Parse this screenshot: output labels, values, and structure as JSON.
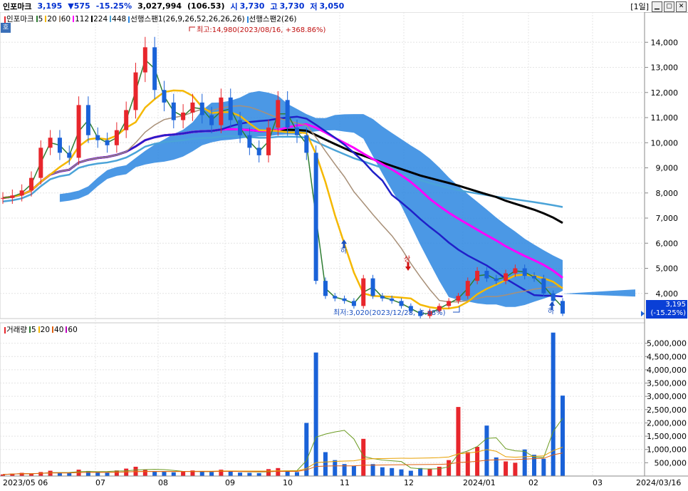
{
  "header": {
    "name": "인포마크",
    "price": "3,195",
    "change": "▼575",
    "change_pct": "-15.25%",
    "volume": "3,027,994",
    "vol_ratio": "(106.53)",
    "open_label": "시",
    "open": "3,730",
    "high_label": "고",
    "high": "3,730",
    "low_label": "저",
    "low": "3,050",
    "period": "[1일]"
  },
  "price_legend": {
    "name": "인포마크",
    "ma": [
      "5",
      "20",
      "60",
      "112",
      "224",
      "448"
    ],
    "span1": "선행스팬1(26,9,26,52,26,26,26)",
    "span2": "선행스팬2(26)",
    "ho_button": "호"
  },
  "volume_legend": {
    "name": "거래량",
    "ma": [
      "5",
      "20",
      "40",
      "60"
    ]
  },
  "annotations": {
    "high": "최고:14,980(2023/08/16, +368.86%)",
    "low": "최저:3,020(2023/12/28, -5.48%)",
    "ha1": "하",
    "sang": "상",
    "ha2": "하"
  },
  "price_box": {
    "price": "3,195",
    "pct": "(-15.25%)"
  },
  "colors": {
    "up": "#e8262c",
    "down": "#1a62d8",
    "ma5": "#2e7d32",
    "ma20": "#f5b800",
    "ma60": "#a89078",
    "ma112": "#ff00ff",
    "ma224": "#000000",
    "ma448": "#4aa3d8",
    "cloud": "#2b86e0",
    "ma_blue": "#2020c8"
  },
  "chart_data": [
    {
      "type": "candlestick",
      "title": "인포마크",
      "y_ticks": [
        4000,
        5000,
        6000,
        7000,
        8000,
        9000,
        10000,
        11000,
        12000,
        13000,
        14000
      ],
      "y_tick_labels": [
        "4,000",
        "5,000",
        "6,000",
        "7,000",
        "8,000",
        "9,000",
        "10,000",
        "11,000",
        "12,000",
        "13,000",
        "14,000"
      ],
      "ylim": [
        3000,
        15200
      ],
      "x_labels": [
        "2023/05 06",
        "07",
        "08",
        "09",
        "10",
        "11",
        "12",
        "2024/01",
        "02",
        "03",
        "2024/03/16"
      ],
      "closes": [
        7800,
        7900,
        8100,
        8600,
        9800,
        10200,
        9600,
        9400,
        11500,
        10300,
        10100,
        9900,
        10500,
        11300,
        12800,
        13800,
        12100,
        11600,
        10900,
        11200,
        11600,
        11100,
        10700,
        11800,
        10900,
        10300,
        9800,
        9500,
        10600,
        11700,
        10600,
        10300,
        9600,
        4500,
        3900,
        3800,
        3700,
        3500,
        4600,
        3900,
        3800,
        3700,
        3500,
        3300,
        3100,
        3300,
        3500,
        3700,
        3900,
        4500,
        4900,
        4600,
        4500,
        4800,
        5000,
        4700,
        4600,
        4000,
        3700,
        3195
      ],
      "last": 3195,
      "high": 14980,
      "low": 3020
    },
    {
      "type": "bar",
      "title": "거래량",
      "y_ticks": [
        500000,
        1000000,
        1500000,
        2000000,
        2500000,
        3000000,
        3500000,
        4000000,
        4500000,
        5000000
      ],
      "y_tick_labels": [
        "500,000",
        "1,000,000",
        "1,500,000",
        "2,000,000",
        "2,500,000",
        "3,000,000",
        "3,500,000",
        "4,000,000",
        "4,500,000",
        "5,000,000"
      ],
      "ylim": [
        0,
        5500000
      ],
      "values": [
        60000,
        90000,
        120000,
        80000,
        150000,
        200000,
        110000,
        130000,
        240000,
        190000,
        160000,
        140000,
        210000,
        280000,
        350000,
        230000,
        180000,
        160000,
        140000,
        170000,
        210000,
        160000,
        150000,
        240000,
        170000,
        130000,
        120000,
        110000,
        260000,
        300000,
        200000,
        150000,
        2000000,
        4650000,
        900000,
        600000,
        450000,
        380000,
        1400000,
        450000,
        330000,
        300000,
        250000,
        200000,
        300000,
        280000,
        350000,
        600000,
        2600000,
        900000,
        1100000,
        1900000,
        700000,
        550000,
        500000,
        1000000,
        800000,
        650000,
        5400000,
        3027994
      ]
    }
  ]
}
